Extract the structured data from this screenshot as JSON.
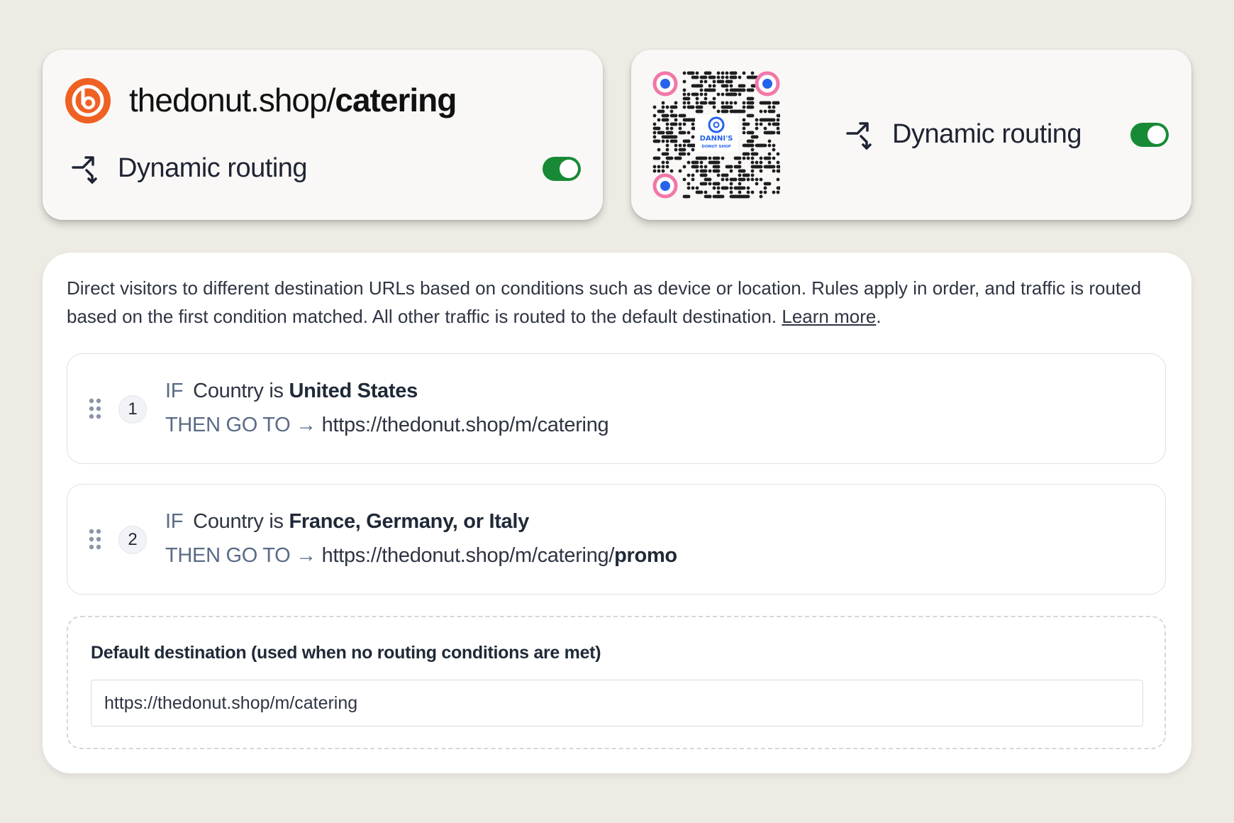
{
  "link_card": {
    "domain": "thedonut.shop/",
    "slug": "catering",
    "routing_label": "Dynamic routing",
    "routing_enabled": true
  },
  "qr_card": {
    "qr_logo_text": "DANNI'S",
    "qr_logo_subtext": "DONUT SHOP",
    "routing_label": "Dynamic routing",
    "routing_enabled": true
  },
  "routing": {
    "description": "Direct visitors to different destination URLs based on conditions such as device or location. Rules apply in order, and traffic is routed based on the first condition matched. All other traffic is routed to the default destination.",
    "learn_more": "Learn more",
    "period": ".",
    "if_keyword": "IF",
    "then_keyword": "THEN GO TO",
    "arrow": "→",
    "rules": [
      {
        "number": "1",
        "condition": "Country is",
        "value": "United States",
        "url": "https://thedonut.shop/m/catering",
        "url_emphasis": ""
      },
      {
        "number": "2",
        "condition": "Country is",
        "value": "France, Germany, or Italy",
        "url": "https://thedonut.shop/m/catering/",
        "url_emphasis": "promo"
      }
    ],
    "default_label": "Default destination (used when no routing conditions are met)",
    "default_value": "https://thedonut.shop/m/catering"
  },
  "colors": {
    "background": "#eeeae4",
    "brand_orange": "#ee6123",
    "toggle_on": "#188a36",
    "keyword": "#5a6b86",
    "qr_corner_outer": "#f178a8",
    "qr_corner_inner": "#2563eb"
  }
}
